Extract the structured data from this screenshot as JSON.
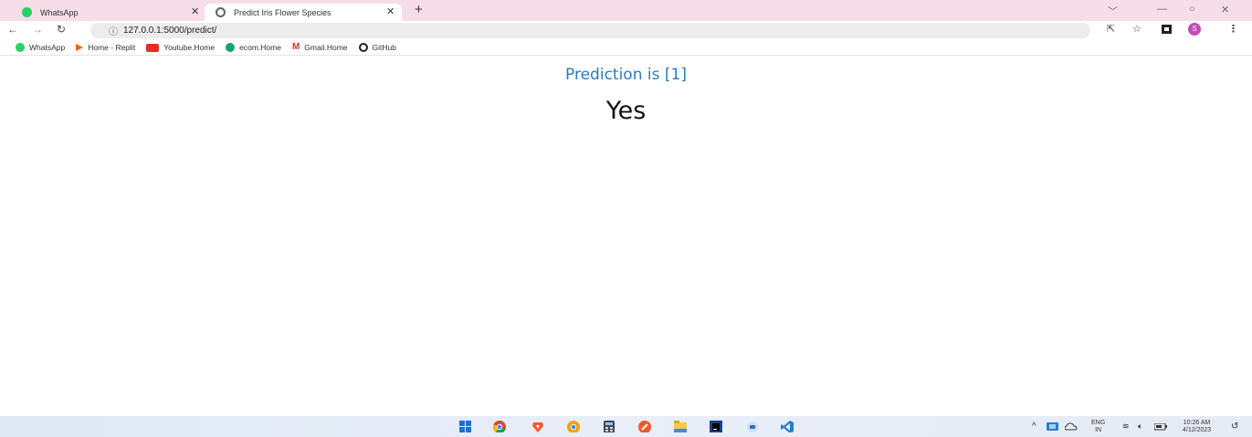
{
  "browser": {
    "tabs": [
      {
        "title": "WhatsApp",
        "favicon": "whatsapp-icon",
        "active": false
      },
      {
        "title": "Predict Iris Flower Species",
        "favicon": "globe-icon",
        "active": true
      }
    ],
    "tab_close_glyph": "✕",
    "new_tab_glyph": "+",
    "url": "127.0.0.1:5000/predict/",
    "profile_initial": "S",
    "bookmarks": [
      {
        "label": "WhatsApp",
        "icon": "whatsapp-icon"
      },
      {
        "label": "Home - Replit",
        "icon": "replit-icon"
      },
      {
        "label": "Youtube.Home",
        "icon": "youtube-icon"
      },
      {
        "label": "ecom.Home",
        "icon": "ecom-icon"
      },
      {
        "label": "Gmail.Home",
        "icon": "gmail-icon"
      },
      {
        "label": "GitHub",
        "icon": "github-icon"
      }
    ],
    "tab_strip_color": "#f7dde8"
  },
  "page": {
    "prediction_text": "Prediction is [1]",
    "result_text": "Yes",
    "prediction_color": "#2c7bc0"
  },
  "taskbar": {
    "apps": [
      "windows-start-icon",
      "chrome-icon",
      "brave-icon",
      "chrome-canary-icon",
      "calculator-icon",
      "postman-icon",
      "file-explorer-icon",
      "pycharm-icon",
      "messaging-icon",
      "vscode-icon"
    ],
    "language_top": "ENG",
    "language_bottom": "IN",
    "time": "10:26 AM",
    "date": "4/12/2023"
  }
}
